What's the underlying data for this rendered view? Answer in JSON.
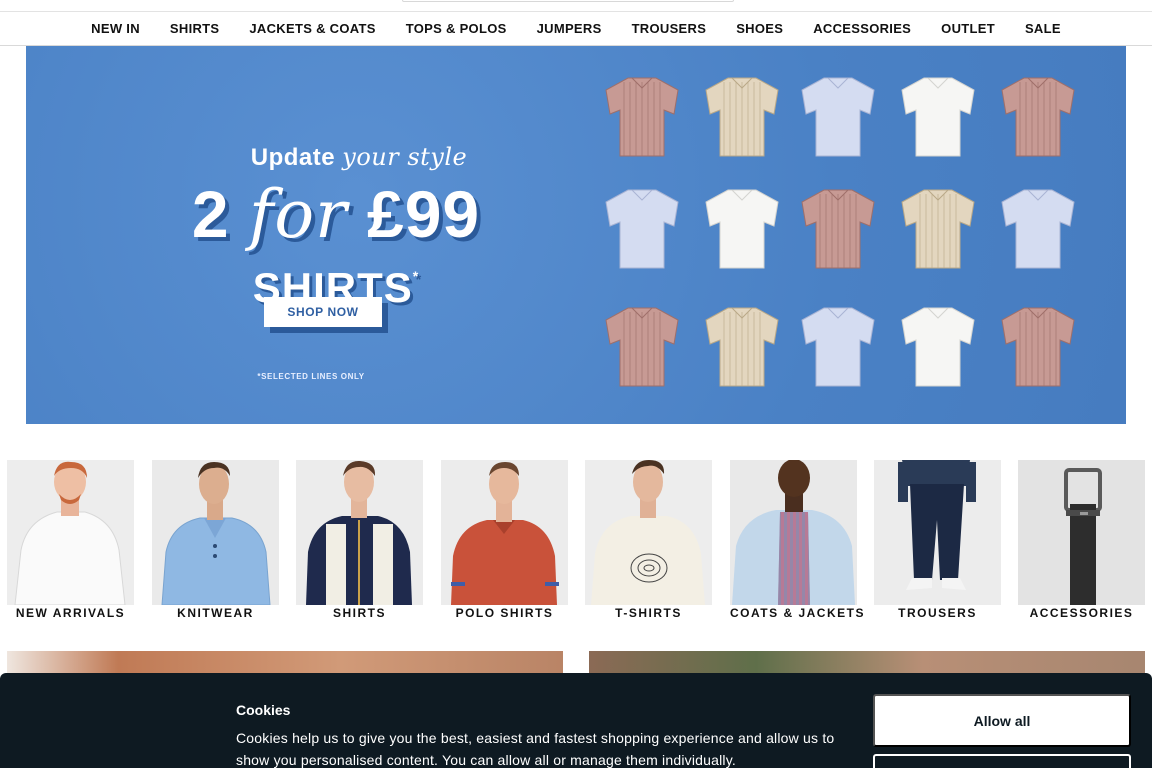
{
  "nav": {
    "items": [
      "NEW IN",
      "SHIRTS",
      "JACKETS & COATS",
      "TOPS & POLOS",
      "JUMPERS",
      "TROUSERS",
      "SHOES",
      "ACCESSORIES",
      "OUTLET",
      "SALE"
    ]
  },
  "hero": {
    "update": "Update",
    "your_style": "your style",
    "two": "2",
    "for": "for",
    "price": "£99",
    "shirts": "SHIRTS",
    "asterisk": "*",
    "shop_now": "SHOP NOW",
    "note": "*SELECTED LINES ONLY",
    "colors": {
      "background": "#4f86c9",
      "shadow": "#2b5a9a"
    }
  },
  "categories": [
    {
      "label": "NEW ARRIVALS"
    },
    {
      "label": "KNITWEAR"
    },
    {
      "label": "SHIRTS"
    },
    {
      "label": "POLO SHIRTS"
    },
    {
      "label": "T-SHIRTS"
    },
    {
      "label": "COATS & JACKETS"
    },
    {
      "label": "TROUSERS"
    },
    {
      "label": "ACCESSORIES"
    }
  ],
  "cookie": {
    "title": "Cookies",
    "text": "Cookies help us to give you the best, easiest and fastest shopping experience and allow us to show you personalised content. You can allow all or manage them individually.",
    "allow_all": "Allow all"
  }
}
